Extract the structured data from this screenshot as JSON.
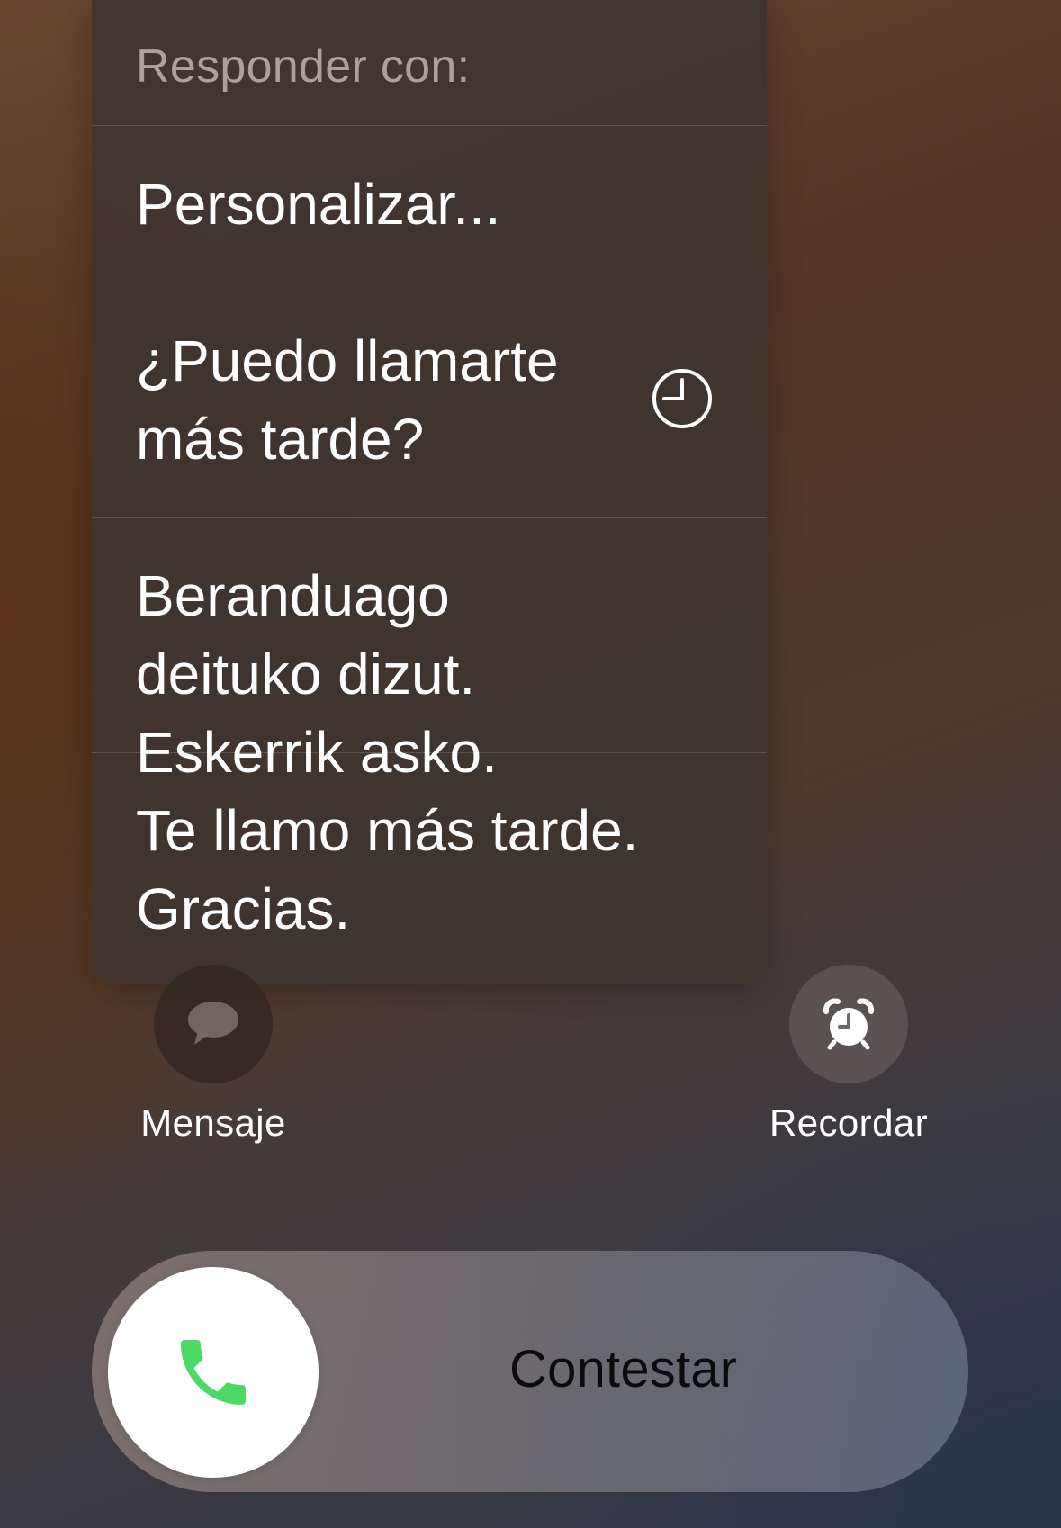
{
  "quick_reply_menu": {
    "header": "Responder con:",
    "items": [
      {
        "label": "Personalizar...",
        "icon": null
      },
      {
        "label": "¿Puedo llamarte más tarde?",
        "icon": "clock-icon"
      },
      {
        "label": "Beranduago deituko dizut. Eskerrik asko.",
        "icon": null
      },
      {
        "label": "Te llamo más tarde. Gracias.",
        "icon": null
      }
    ]
  },
  "actions": {
    "message": {
      "label": "Mensaje",
      "icon": "speech-bubble-icon"
    },
    "remind": {
      "label": "Recordar",
      "icon": "alarm-clock-icon"
    }
  },
  "answer_slider": {
    "label": "Contestar",
    "icon": "phone-icon",
    "accent_color": "#4cd964"
  }
}
